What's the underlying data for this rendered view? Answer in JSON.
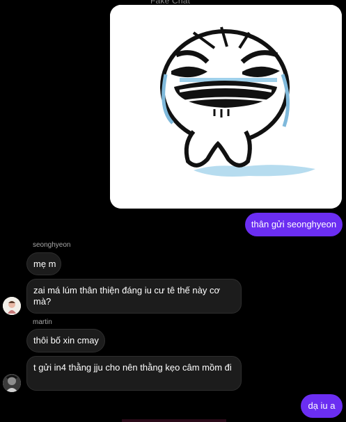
{
  "header": {
    "watermark": "Fake Chat"
  },
  "image_message": {
    "alt": "crying meme face sticker"
  },
  "messages": {
    "out1": "thân gửi seonghyeon",
    "group1_sender": "seonghyeon",
    "in1": "mẹ m",
    "in2": "zai má lúm thân thiện đáng iu cư tê thế này cơ mà?",
    "group2_sender": "martin",
    "in3": "thôi bố xin cmay",
    "in4": "t gửi in4 thằng jju cho nên thằng kẹo câm mồm đi",
    "out2": "dạ iu a"
  },
  "colors": {
    "outgoing": "#6b2ef2",
    "incoming": "#1c1c1c",
    "background": "#000000"
  }
}
